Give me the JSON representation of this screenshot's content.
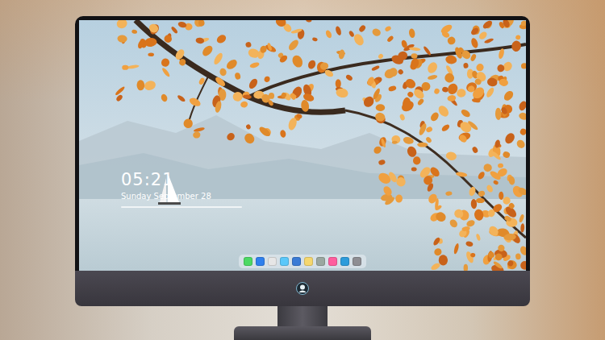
{
  "screen": {
    "clock": {
      "time": "05:21",
      "date": "Sunday September 28"
    }
  },
  "dock": {
    "apps": [
      {
        "color": "#4cd964"
      },
      {
        "color": "#2f80ed"
      },
      {
        "color": "#e6e6e6"
      },
      {
        "color": "#5ac8fa"
      },
      {
        "color": "#3a7bd5"
      },
      {
        "color": "#f5d76e"
      },
      {
        "color": "#9aa7a0"
      },
      {
        "color": "#ff5e9e"
      },
      {
        "color": "#2d9cdb"
      },
      {
        "color": "#8e8e93"
      }
    ]
  }
}
